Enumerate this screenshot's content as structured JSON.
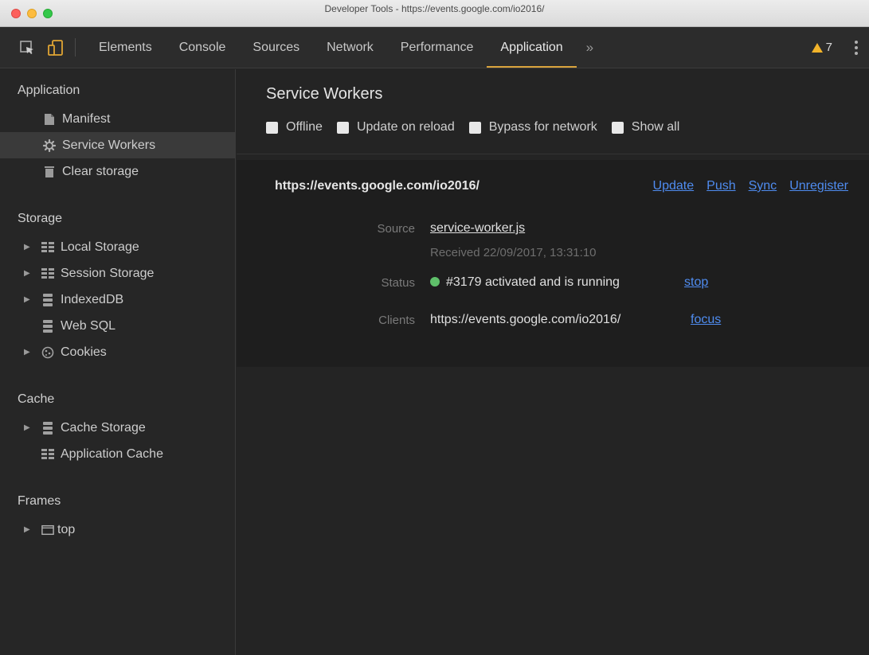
{
  "window": {
    "title": "Developer Tools - https://events.google.com/io2016/"
  },
  "tabs": [
    {
      "label": "Elements"
    },
    {
      "label": "Console"
    },
    {
      "label": "Sources"
    },
    {
      "label": "Network"
    },
    {
      "label": "Performance"
    },
    {
      "label": "Application"
    }
  ],
  "active_tab": "Application",
  "toolbar": {
    "more_tabs": "»",
    "warning_count": "7"
  },
  "sidebar": {
    "application": {
      "title": "Application",
      "items": [
        {
          "label": "Manifest",
          "icon": "document-icon"
        },
        {
          "label": "Service Workers",
          "icon": "gear-icon"
        },
        {
          "label": "Clear storage",
          "icon": "trash-icon"
        }
      ]
    },
    "storage": {
      "title": "Storage",
      "items": [
        {
          "label": "Local Storage",
          "icon": "grid-icon"
        },
        {
          "label": "Session Storage",
          "icon": "grid-icon"
        },
        {
          "label": "IndexedDB",
          "icon": "database-icon"
        },
        {
          "label": "Web SQL",
          "icon": "database-icon"
        },
        {
          "label": "Cookies",
          "icon": "cookie-icon"
        }
      ]
    },
    "cache": {
      "title": "Cache",
      "items": [
        {
          "label": "Cache Storage",
          "icon": "database-icon"
        },
        {
          "label": "Application Cache",
          "icon": "grid-icon"
        }
      ]
    },
    "frames": {
      "title": "Frames",
      "items": [
        {
          "label": "top",
          "icon": "frame-icon"
        }
      ]
    }
  },
  "main": {
    "title": "Service Workers",
    "options": {
      "offline": "Offline",
      "update_on_reload": "Update on reload",
      "bypass_for_network": "Bypass for network",
      "show_all": "Show all"
    },
    "worker": {
      "scope": "https://events.google.com/io2016/",
      "actions": {
        "update": "Update",
        "push": "Push",
        "sync": "Sync",
        "unregister": "Unregister"
      },
      "source_label": "Source",
      "source_file": "service-worker.js",
      "received": "Received 22/09/2017, 13:31:10",
      "status_label": "Status",
      "status_text": "#3179 activated and is running",
      "status_action": "stop",
      "clients_label": "Clients",
      "client_url": "https://events.google.com/io2016/",
      "client_action": "focus"
    }
  },
  "colors": {
    "accent_tab": "#d9a33c",
    "link": "#4f8cf0",
    "status_running": "#5fc06a",
    "warning": "#f2b32a"
  }
}
